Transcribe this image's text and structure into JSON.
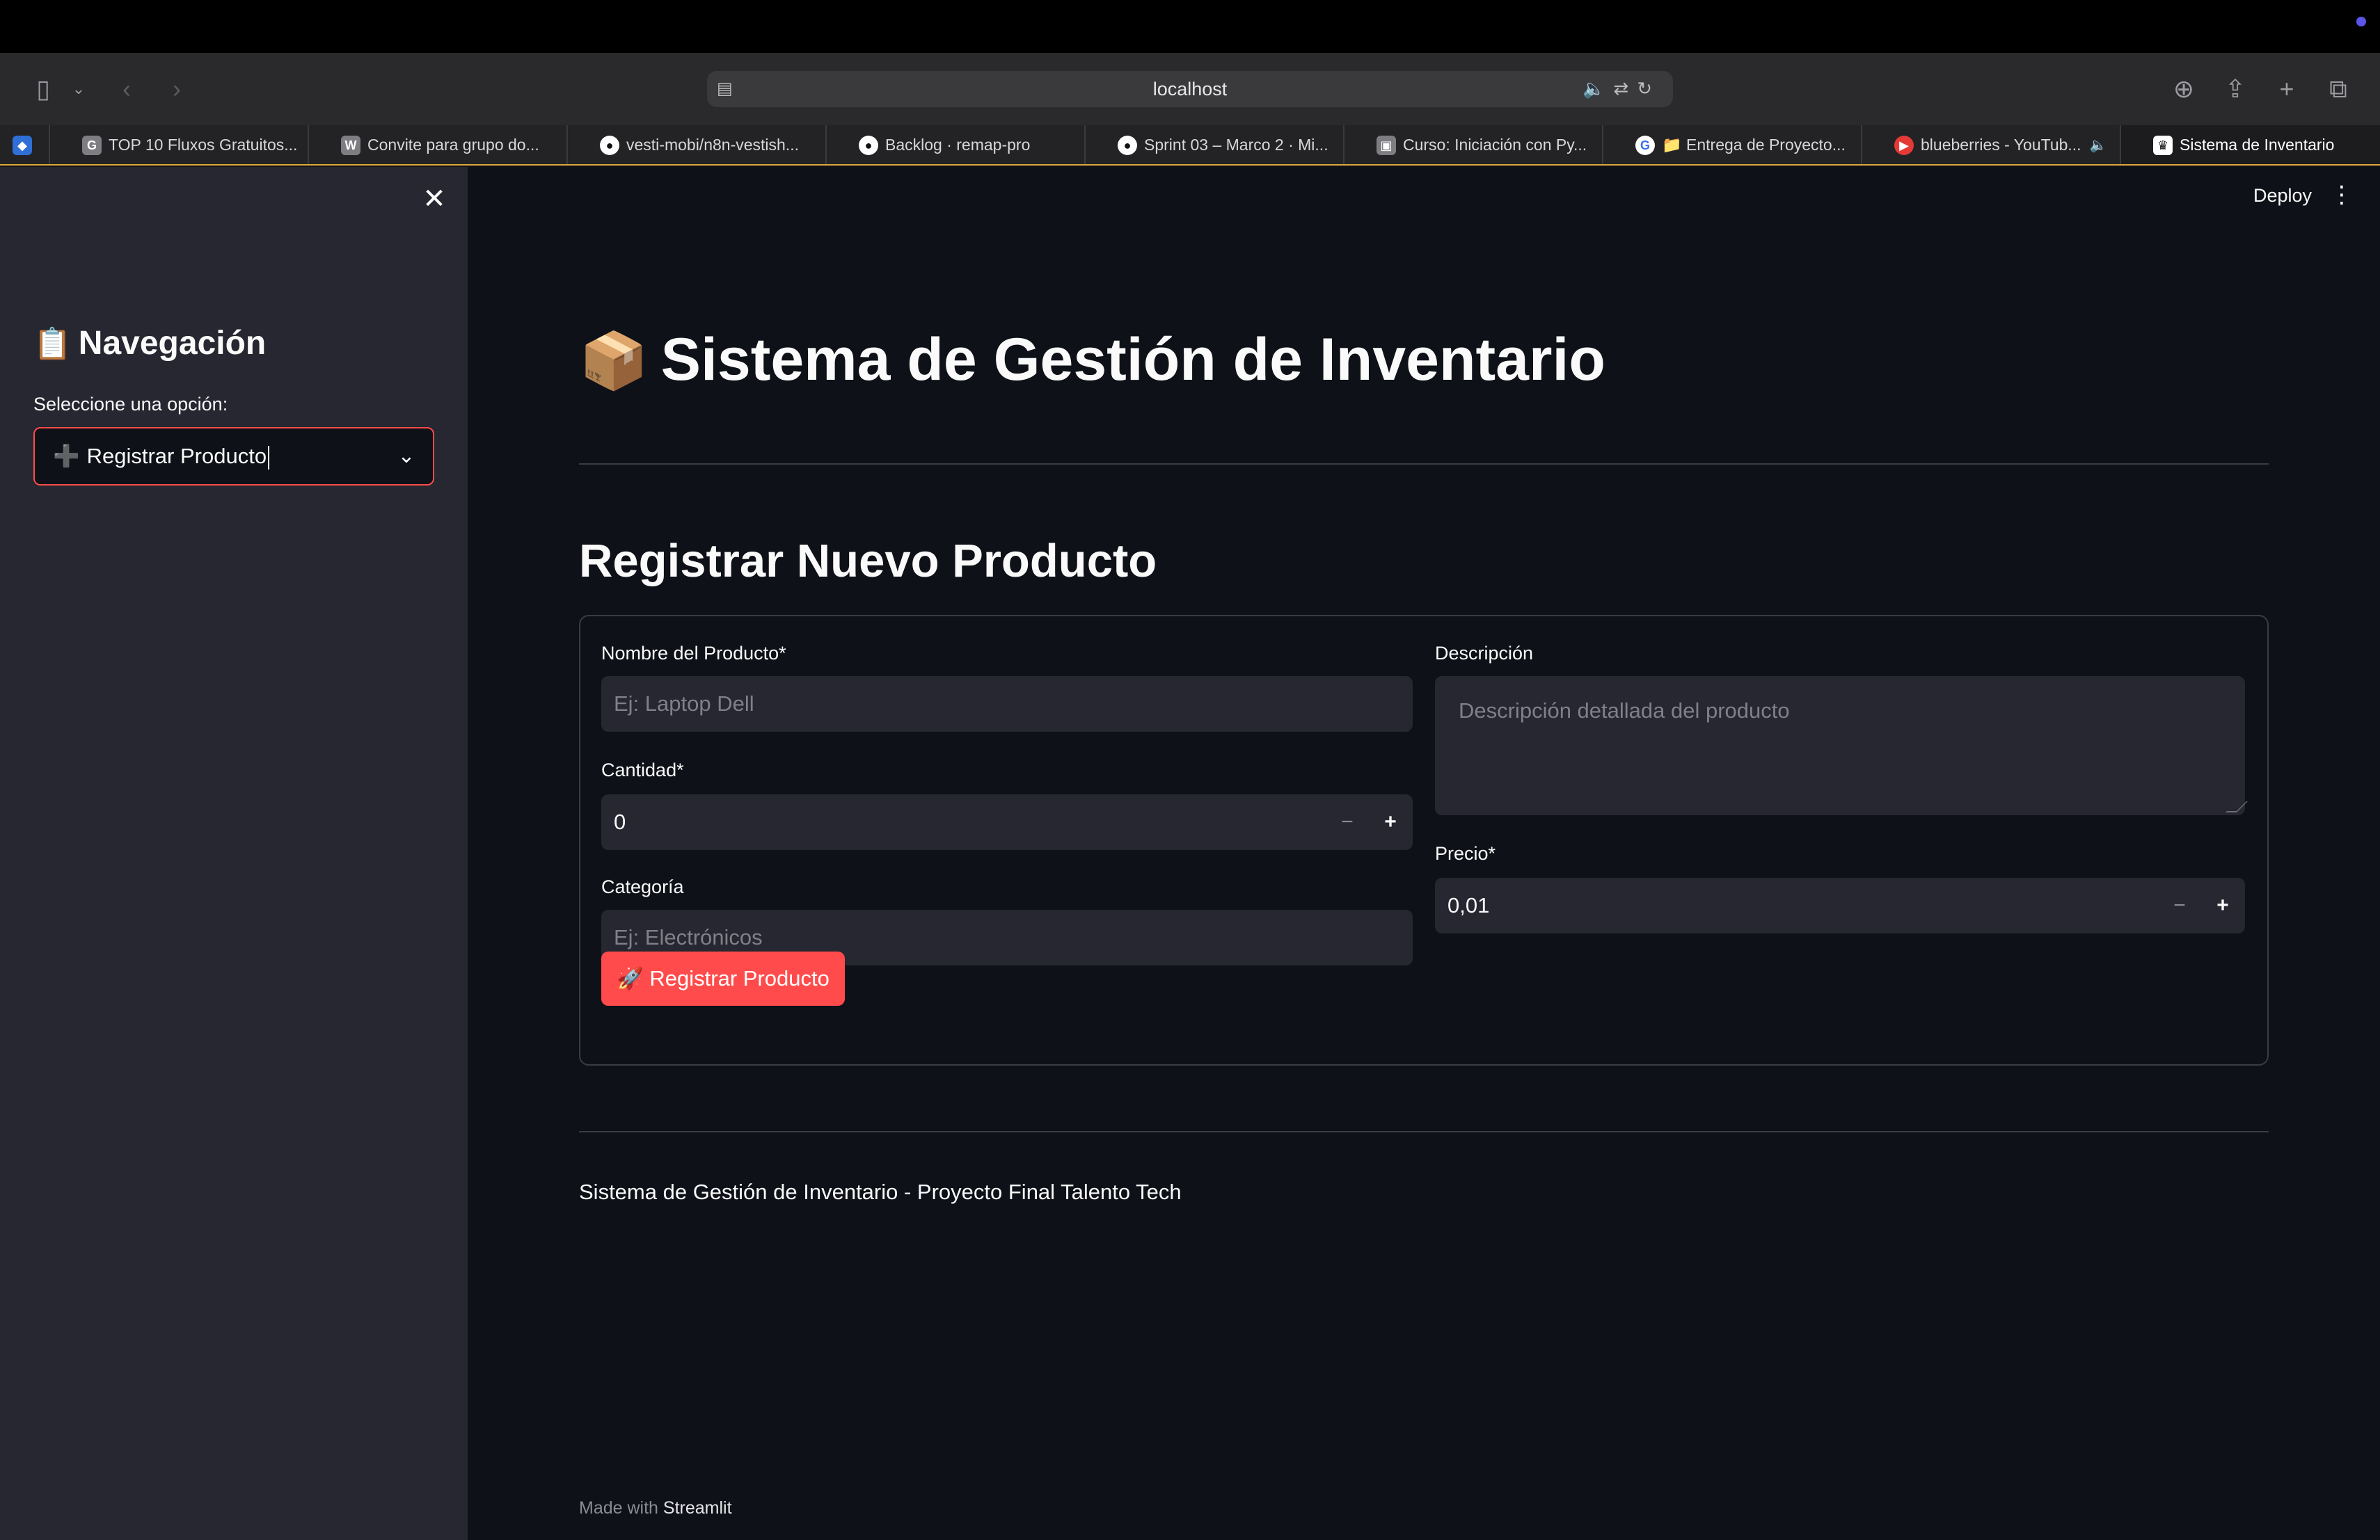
{
  "browser": {
    "url": "localhost",
    "tabs": [
      {
        "title": "",
        "icon": "app-favicon"
      },
      {
        "title": "TOP 10 Fluxos Gratuitos...",
        "icon": "g-favicon"
      },
      {
        "title": "Convite para grupo do...",
        "icon": "w-favicon"
      },
      {
        "title": "vesti-mobi/n8n-vestish...",
        "icon": "github-icon"
      },
      {
        "title": "Backlog · remap-pro",
        "icon": "github-icon"
      },
      {
        "title": "Sprint 03 – Marco 2 · Mi...",
        "icon": "github-icon"
      },
      {
        "title": "Curso: Iniciación con Py...",
        "icon": "course-favicon"
      },
      {
        "title": "📁 Entrega de Proyecto...",
        "icon": "google-icon"
      },
      {
        "title": "blueberries - YouTub...",
        "icon": "youtube-icon"
      },
      {
        "title": "Sistema de Inventario",
        "icon": "streamlit-icon"
      }
    ]
  },
  "sidebar": {
    "title_emoji": "📋",
    "title": "Navegación",
    "select_label": "Seleccione una opción:",
    "select_icon": "➕",
    "select_value": "Registrar Producto"
  },
  "header": {
    "deploy_label": "Deploy"
  },
  "main": {
    "title_emoji": "📦",
    "title": "Sistema de Gestión de Inventario",
    "section_title": "Registrar Nuevo Producto",
    "form": {
      "name_label": "Nombre del Producto*",
      "name_placeholder": "Ej: Laptop Dell",
      "quantity_label": "Cantidad*",
      "quantity_value": "0",
      "category_label": "Categoría",
      "category_placeholder": "Ej: Electrónicos",
      "description_label": "Descripción",
      "description_placeholder": "Descripción detallada del producto",
      "price_label": "Precio*",
      "price_value": "0,01",
      "submit_label": "🚀 Registrar Producto"
    },
    "footer_text": "Sistema de Gestión de Inventario - Proyecto Final Talento Tech"
  },
  "made_with": {
    "prefix": "Made with",
    "brand": "Streamlit"
  },
  "colors": {
    "accent": "#ff4b4b",
    "background": "#0e1117",
    "sidebar": "#262730",
    "input": "#262730"
  }
}
